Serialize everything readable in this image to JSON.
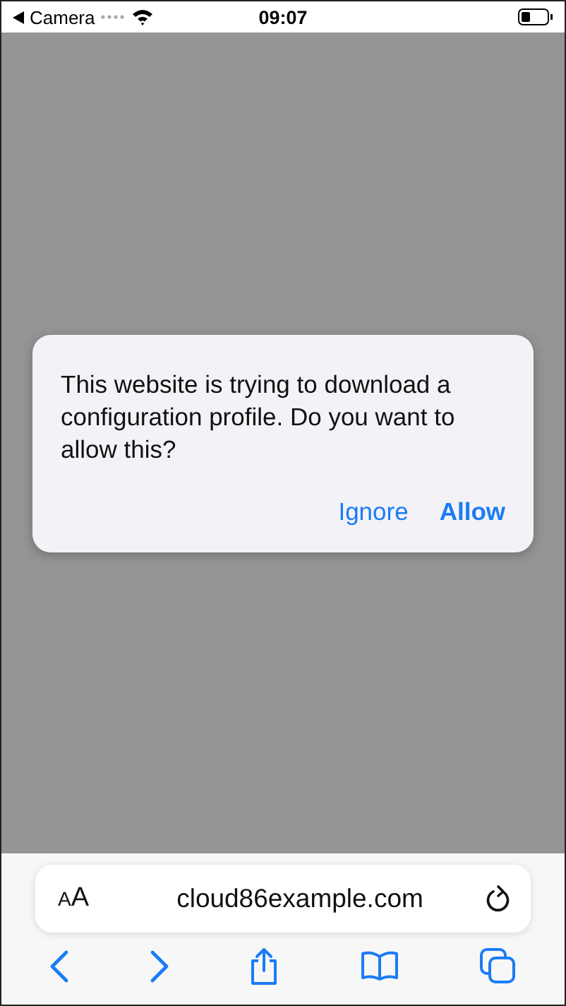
{
  "status_bar": {
    "back_label": "Camera",
    "time": "09:07"
  },
  "dialog": {
    "message": "This website is trying to download a configuration profile. Do you want to allow this?",
    "buttons": [
      {
        "label": "Ignore",
        "kind": "plain"
      },
      {
        "label": "Allow",
        "kind": "preferred"
      }
    ]
  },
  "address_bar": {
    "text_size_label": "AA",
    "url": "cloud86example.com"
  }
}
